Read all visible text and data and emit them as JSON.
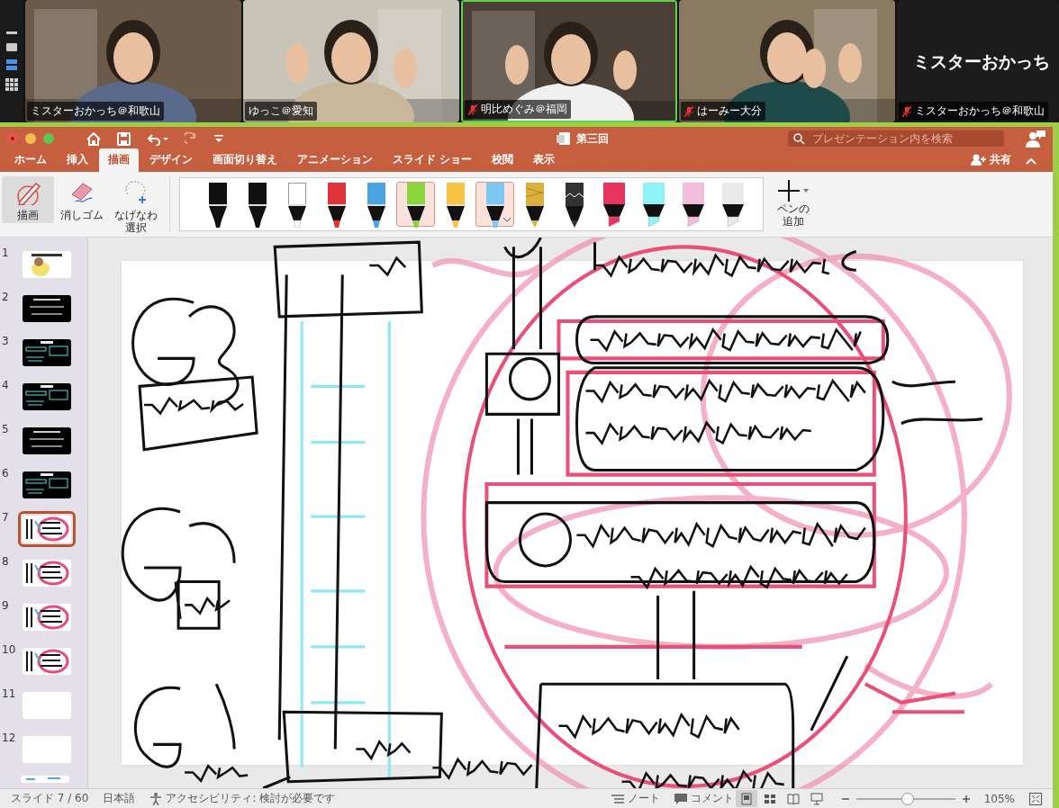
{
  "meeting": {
    "tiles": [
      {
        "kind": "video",
        "name": "ミスターおかっち＠和歌山",
        "muted": false,
        "active": false
      },
      {
        "kind": "video",
        "name": "ゆっこ＠愛知",
        "muted": false,
        "active": false
      },
      {
        "kind": "video",
        "name": "明比めぐみ＠福岡",
        "muted": true,
        "active": true
      },
      {
        "kind": "video",
        "name": "はーみー大分",
        "muted": true,
        "active": false
      },
      {
        "kind": "name_only",
        "display": "ミスターおかっち",
        "name": "ミスターおかっち＠和歌山",
        "muted": true,
        "active": false
      }
    ]
  },
  "window": {
    "title": "第三回",
    "search": {
      "placeholder": "プレゼンテーション内を検索"
    },
    "share": "共有"
  },
  "tabs": [
    {
      "label": "ホーム",
      "selected": false
    },
    {
      "label": "挿入",
      "selected": false
    },
    {
      "label": "描画",
      "selected": true
    },
    {
      "label": "デザイン",
      "selected": false
    },
    {
      "label": "画面切り替え",
      "selected": false
    },
    {
      "label": "アニメーション",
      "selected": false
    },
    {
      "label": "スライド ショー",
      "selected": false
    },
    {
      "label": "校閲",
      "selected": false
    },
    {
      "label": "表示",
      "selected": false
    }
  ],
  "tools": [
    {
      "kind": "draw",
      "label": "描画",
      "selected": true
    },
    {
      "kind": "eraser",
      "label": "消しゴム",
      "selected": false
    },
    {
      "kind": "lasso",
      "label": "なげなわ選択",
      "selected": false
    }
  ],
  "pens": [
    {
      "kind": "pen",
      "color": "#111111",
      "selected": false,
      "dropdown": false
    },
    {
      "kind": "pen",
      "color": "#111111",
      "selected": false,
      "dropdown": false
    },
    {
      "kind": "pen",
      "color": "#ffffff",
      "selected": false,
      "dropdown": false
    },
    {
      "kind": "pen",
      "color": "#e0333a",
      "selected": false,
      "dropdown": false
    },
    {
      "kind": "pen",
      "color": "#4aa3e0",
      "selected": false,
      "dropdown": false
    },
    {
      "kind": "pen",
      "color": "#8ad43c",
      "selected": true,
      "dropdown": false
    },
    {
      "kind": "pen",
      "color": "#f6c342",
      "selected": false,
      "dropdown": false
    },
    {
      "kind": "pen",
      "color": "#7cc8f2",
      "selected": true,
      "dropdown": true
    },
    {
      "kind": "pencil",
      "color": "#d9b13c",
      "selected": false,
      "dropdown": false
    },
    {
      "kind": "glitter",
      "color": "#333333",
      "selected": false,
      "dropdown": false
    },
    {
      "kind": "highlighter",
      "color": "#e8335f",
      "selected": false,
      "dropdown": false
    },
    {
      "kind": "highlighter",
      "color": "#8ff3f5",
      "selected": false,
      "dropdown": false
    },
    {
      "kind": "highlighter",
      "color": "#f2bddb",
      "selected": false,
      "dropdown": false
    },
    {
      "kind": "highlighter",
      "color": "#e9e9e9",
      "selected": false,
      "dropdown": false
    }
  ],
  "add_pen": "ペンの追加",
  "slides": [
    {
      "number": "1",
      "kind": "illustration",
      "selected": false
    },
    {
      "number": "2",
      "kind": "dark",
      "selected": false
    },
    {
      "number": "3",
      "kind": "dark_ink",
      "selected": false
    },
    {
      "number": "4",
      "kind": "dark_ink",
      "selected": false
    },
    {
      "number": "5",
      "kind": "dark",
      "selected": false
    },
    {
      "number": "6",
      "kind": "dark_ink",
      "selected": false
    },
    {
      "number": "7",
      "kind": "ink",
      "selected": true
    },
    {
      "number": "8",
      "kind": "ink",
      "selected": false
    },
    {
      "number": "9",
      "kind": "ink",
      "selected": false
    },
    {
      "number": "10",
      "kind": "ink",
      "selected": false
    },
    {
      "number": "11",
      "kind": "blank",
      "selected": false
    },
    {
      "number": "12",
      "kind": "blank",
      "selected": false
    }
  ],
  "status_bar": {
    "slide": "スライド 7 / 60",
    "language": "日本語",
    "accessibility": "アクセシビリティ: 検討が必要です",
    "notes": "ノート",
    "comments": "コメント",
    "views": [
      {
        "kind": "normal",
        "selected": true
      },
      {
        "kind": "sorter",
        "selected": false
      },
      {
        "kind": "reading",
        "selected": false
      },
      {
        "kind": "show",
        "selected": false
      }
    ],
    "zoom": {
      "level": 0.52,
      "reading": "105%"
    }
  }
}
